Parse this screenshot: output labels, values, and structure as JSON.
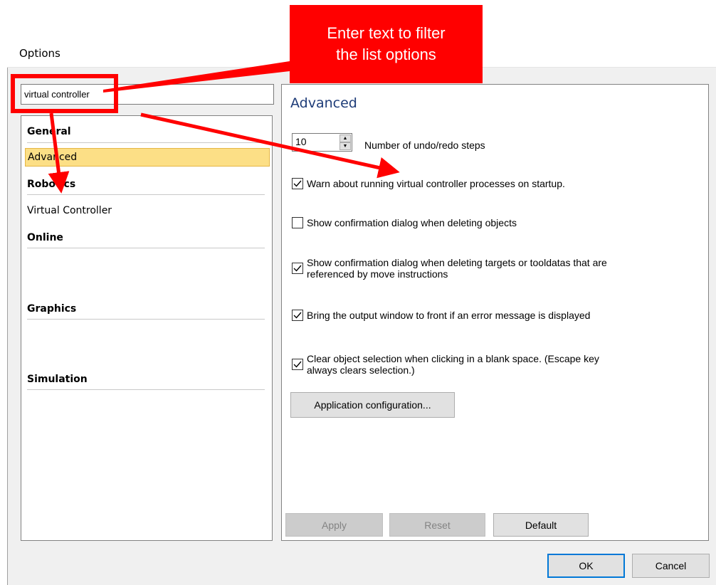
{
  "window": {
    "title": "Options"
  },
  "filter": {
    "value": "virtual controller",
    "placeholder": ""
  },
  "nav": {
    "sections": [
      {
        "header": "General",
        "items": [
          "Advanced"
        ]
      },
      {
        "header": "Robotics",
        "items": [
          "Virtual Controller"
        ]
      },
      {
        "header": "Online",
        "items": []
      },
      {
        "header": "Graphics",
        "items": []
      },
      {
        "header": "Simulation",
        "items": []
      }
    ],
    "selected": "Advanced"
  },
  "content": {
    "title": "Advanced",
    "undo_steps": {
      "value": "10",
      "label": "Number of undo/redo steps"
    },
    "checks": [
      {
        "label": "Warn about running virtual controller processes on startup.",
        "checked": true
      },
      {
        "label": "Show confirmation dialog when deleting objects",
        "checked": false
      },
      {
        "label_line1": "Show confirmation dialog when deleting targets or tooldatas that are",
        "label_line2": "referenced by move instructions",
        "checked": true
      },
      {
        "label": "Bring the output window to front if an error message is displayed",
        "checked": true
      },
      {
        "label_line1": "Clear object selection when clicking in a blank space. (Escape key",
        "label_line2": "always clears selection.)",
        "checked": true
      }
    ],
    "app_config_button": "Application configuration...",
    "apply_button": "Apply",
    "reset_button": "Reset",
    "default_button": "Default"
  },
  "footer": {
    "ok": "OK",
    "cancel": "Cancel"
  },
  "annotation": {
    "line1": "Enter text to filter",
    "line2": "the list  options"
  },
  "colors": {
    "annotation": "#ff0000",
    "selection": "#fcdf86",
    "default_border": "#0078d7",
    "content_title": "#1e3c78"
  }
}
